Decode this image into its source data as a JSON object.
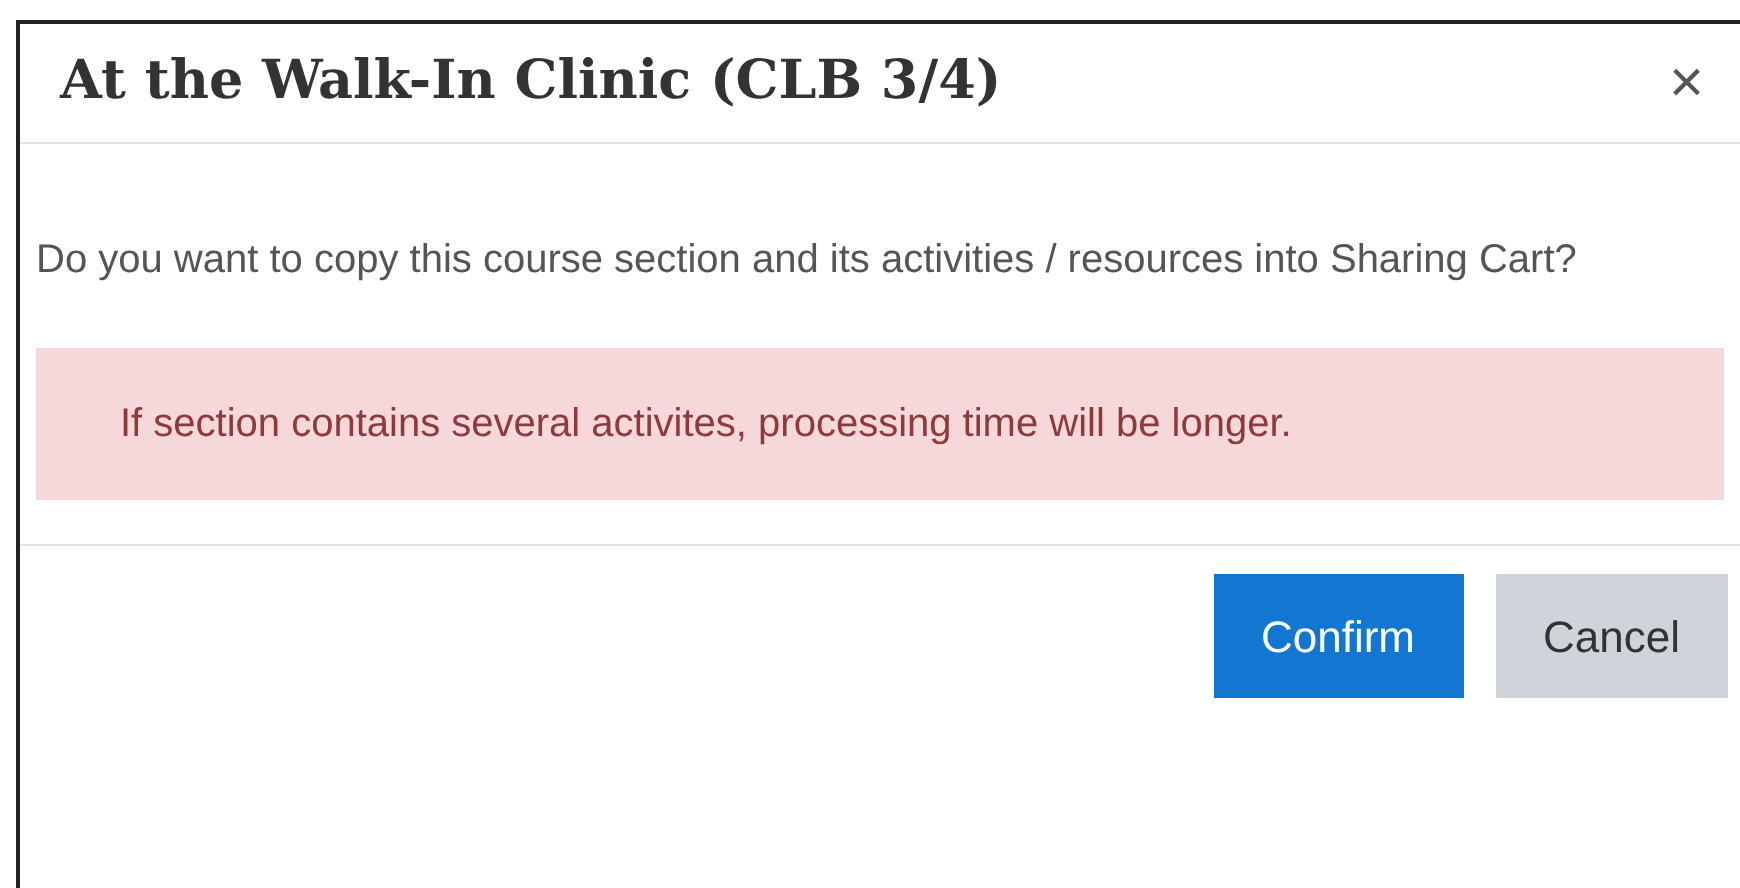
{
  "dialog": {
    "title": "At the Walk-In Clinic (CLB 3/4)",
    "close": "×",
    "message": "Do you want to copy this course section and its activities / resources into Sharing Cart?",
    "alert": "If section contains several activites, processing time will be longer.",
    "buttons": [
      {
        "label": "Confirm",
        "kind": "primary"
      },
      {
        "label": "Cancel",
        "kind": "secondary"
      }
    ]
  }
}
